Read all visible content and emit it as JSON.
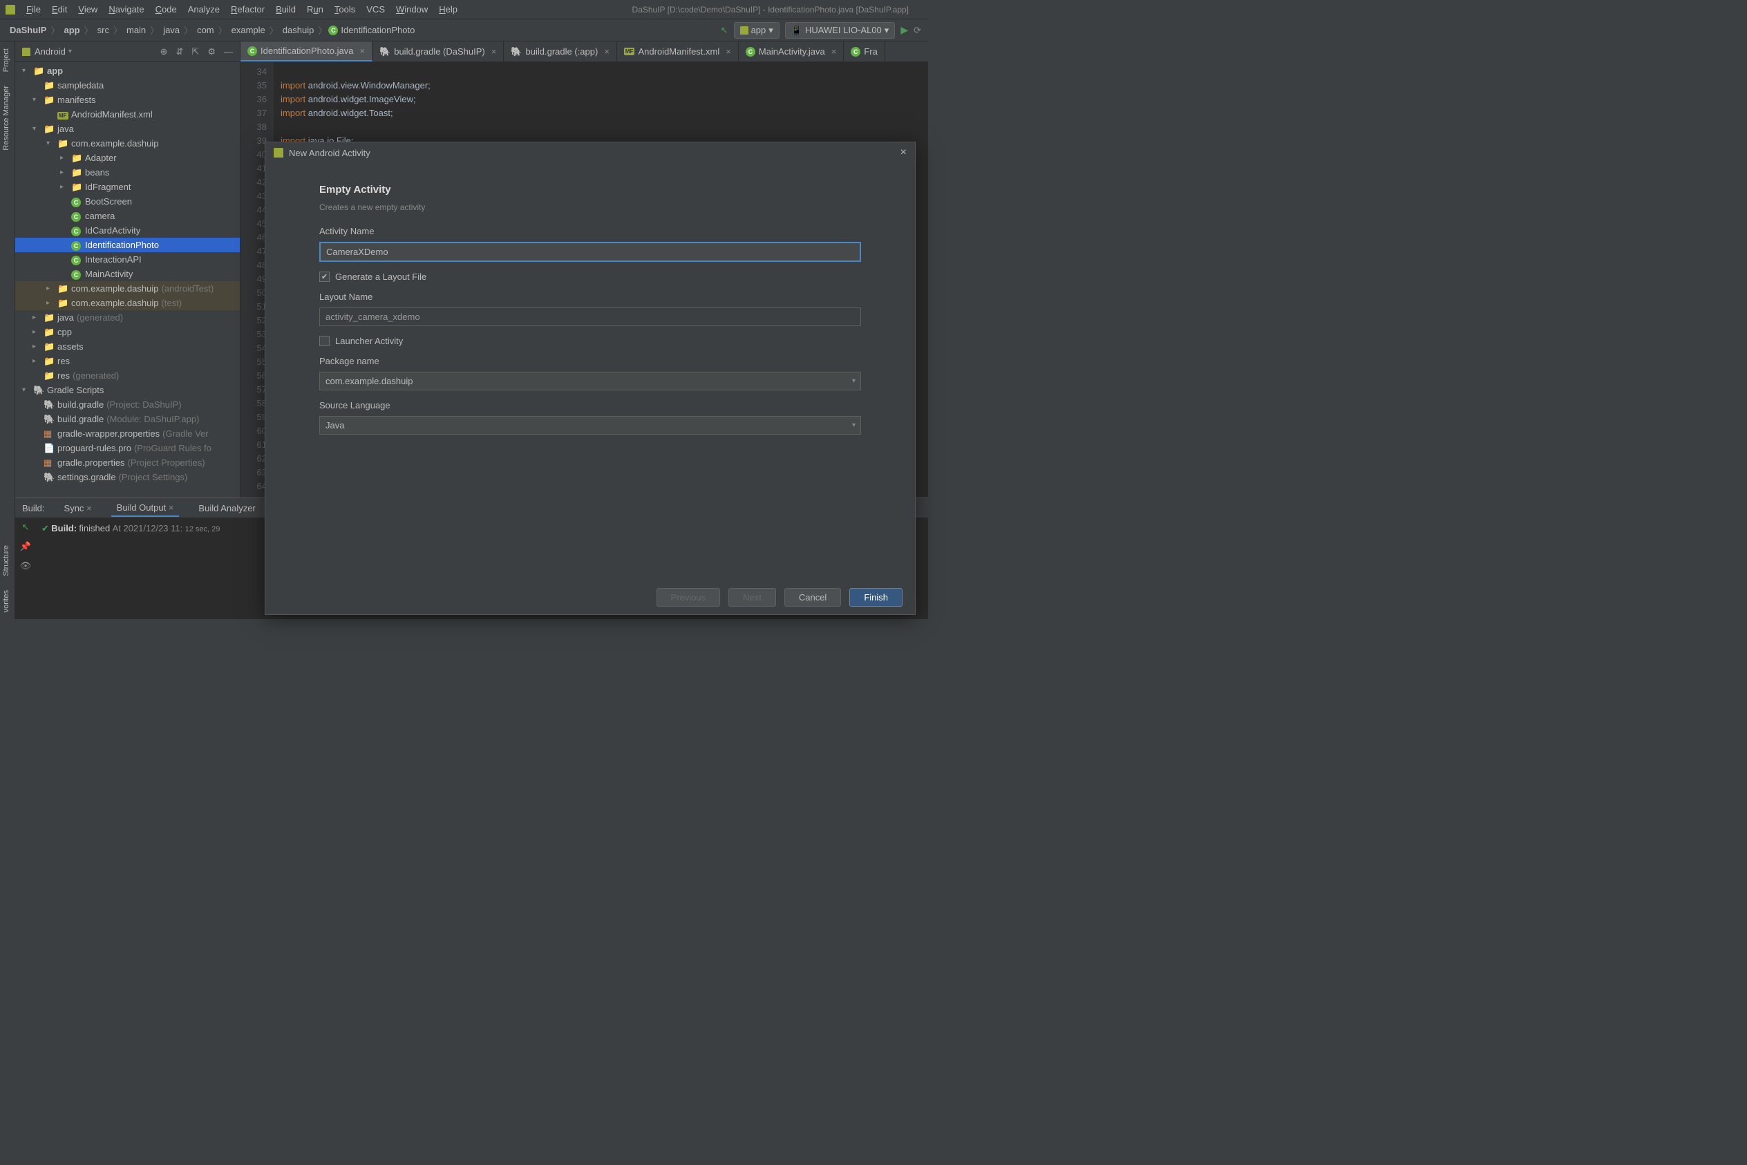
{
  "menu": {
    "file": "File",
    "edit": "Edit",
    "view": "View",
    "navigate": "Navigate",
    "code": "Code",
    "analyze": "Analyze",
    "refactor": "Refactor",
    "build": "Build",
    "run": "Run",
    "tools": "Tools",
    "vcs": "VCS",
    "window": "Window",
    "help": "Help"
  },
  "window_title": "DaShuIP [D:\\code\\Demo\\DaShuIP] - IdentificationPhoto.java [DaShuIP.app]",
  "breadcrumbs": [
    "DaShuIP",
    "app",
    "src",
    "main",
    "java",
    "com",
    "example",
    "dashuip",
    "IdentificationPhoto"
  ],
  "run_config": {
    "module": "app",
    "device": "HUAWEI LIO-AL00"
  },
  "left_tabs": {
    "project": "Project",
    "resource_manager": "Resource Manager",
    "structure": "Structure",
    "favorites": "vorites"
  },
  "project_panel": {
    "title": "Android"
  },
  "tree": {
    "app": "app",
    "sampledata": "sampledata",
    "manifests": "manifests",
    "androidmanifest": "AndroidManifest.xml",
    "java": "java",
    "pkg": "com.example.dashuip",
    "adapter": "Adapter",
    "beans": "beans",
    "idfragment": "IdFragment",
    "bootscreen": "BootScreen",
    "camera": "camera",
    "idcard": "IdCardActivity",
    "idphoto": "IdentificationPhoto",
    "interaction": "InteractionAPI",
    "mainactivity": "MainActivity",
    "pkg_androidtest": "com.example.dashuip",
    "pkg_androidtest_hint": "(androidTest)",
    "pkg_test": "com.example.dashuip",
    "pkg_test_hint": "(test)",
    "java_gen": "java",
    "java_gen_hint": "(generated)",
    "cpp": "cpp",
    "assets": "assets",
    "res": "res",
    "res_gen": "res",
    "res_gen_hint": "(generated)",
    "gradle_scripts": "Gradle Scripts",
    "build_gradle_proj": "build.gradle",
    "build_gradle_proj_hint": "(Project: DaShuIP)",
    "build_gradle_mod": "build.gradle",
    "build_gradle_mod_hint": "(Module: DaShuIP.app)",
    "gradle_wrapper": "gradle-wrapper.properties",
    "gradle_wrapper_hint": "(Gradle Ver",
    "proguard": "proguard-rules.pro",
    "proguard_hint": "(ProGuard Rules fo",
    "gradle_props": "gradle.properties",
    "gradle_props_hint": "(Project Properties)",
    "settings_gradle": "settings.gradle",
    "settings_gradle_hint": "(Project Settings)"
  },
  "editor_tabs": [
    {
      "label": "IdentificationPhoto.java",
      "icon": "c"
    },
    {
      "label": "build.gradle (DaShuIP)",
      "icon": "gradle"
    },
    {
      "label": "build.gradle (:app)",
      "icon": "gradle"
    },
    {
      "label": "AndroidManifest.xml",
      "icon": "mf"
    },
    {
      "label": "MainActivity.java",
      "icon": "c"
    },
    {
      "label": "Fra",
      "icon": "c"
    }
  ],
  "code_lines": {
    "34": "",
    "35": "import android.view.WindowManager;",
    "36": "import android.widget.ImageView;",
    "37": "import android.widget.Toast;",
    "38": "",
    "39": "import java.io.File;"
  },
  "gutter": [
    "34",
    "35",
    "36",
    "37",
    "38",
    "39",
    "40",
    "41",
    "42",
    "43",
    "44",
    "45",
    "46",
    "47",
    "48",
    "49",
    "50",
    "51",
    "52",
    "53",
    "54",
    "55",
    "56",
    "57",
    "58",
    "59",
    "60",
    "61",
    "62",
    "63",
    "64"
  ],
  "build_panel": {
    "label": "Build:",
    "sync": "Sync",
    "output": "Build Output",
    "analyzer": "Build Analyzer",
    "status_prefix": "Build:",
    "status": "finished",
    "at": "At 2021/12/23 11:",
    "timing": "12 sec, 29"
  },
  "dialog": {
    "title": "New Android Activity",
    "heading": "Empty Activity",
    "description": "Creates a new empty activity",
    "activity_name_label": "Activity Name",
    "activity_name_value": "CameraXDemo",
    "generate_layout_label": "Generate a Layout File",
    "layout_name_label": "Layout Name",
    "layout_name_value": "activity_camera_xdemo",
    "launcher_label": "Launcher Activity",
    "package_label": "Package name",
    "package_value": "com.example.dashuip",
    "language_label": "Source Language",
    "language_value": "Java",
    "btn_previous": "Previous",
    "btn_next": "Next",
    "btn_cancel": "Cancel",
    "btn_finish": "Finish"
  }
}
